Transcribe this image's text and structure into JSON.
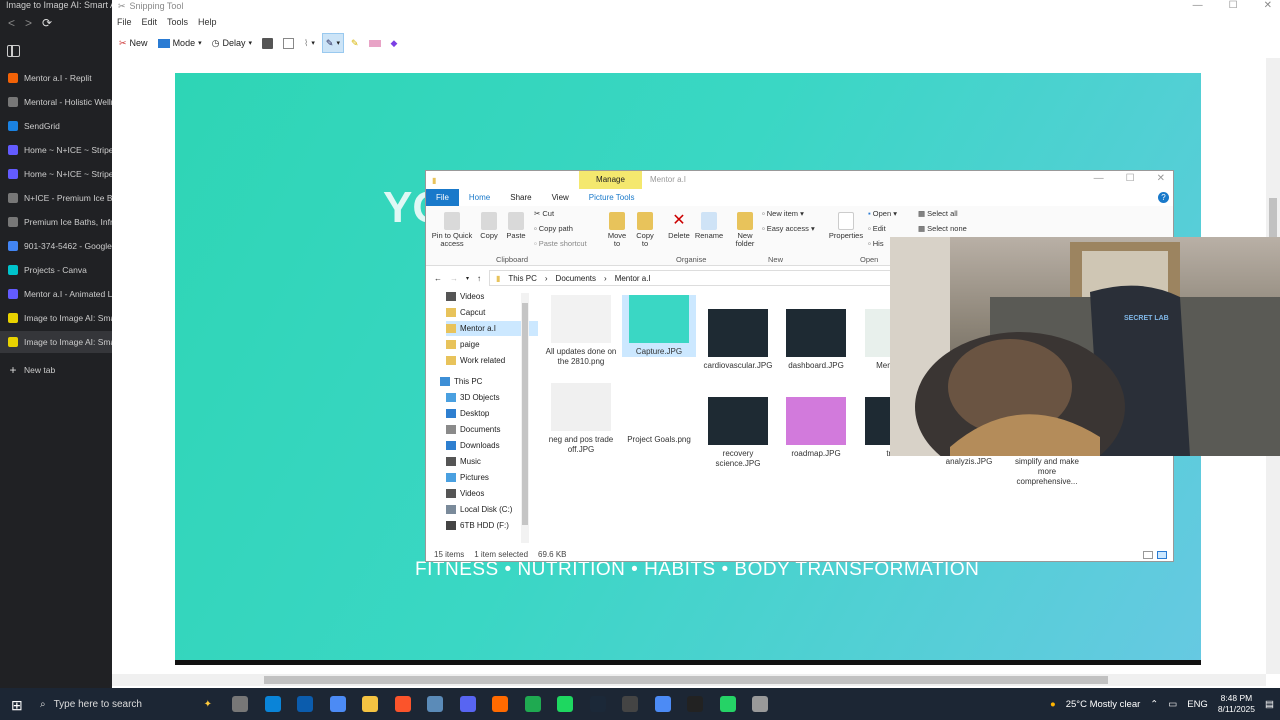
{
  "browser": {
    "title": "Image to Image AI: Smart AI I",
    "tabs": [
      {
        "label": "Mentor a.I - Replit",
        "icon": "replit-icon",
        "color": "#f26207"
      },
      {
        "label": "Mentoral - Holistic Welln",
        "icon": "globe-icon",
        "color": "#777777"
      },
      {
        "label": "SendGrid",
        "icon": "sendgrid-icon",
        "color": "#1a82e2"
      },
      {
        "label": "Home ~ N+ICE ~ Stripe",
        "icon": "stripe-icon",
        "color": "#635bff"
      },
      {
        "label": "Home ~ N+ICE ~ Stripe",
        "icon": "stripe-icon",
        "color": "#635bff"
      },
      {
        "label": "N+ICE - Premium Ice Bat",
        "icon": "globe-icon",
        "color": "#777777"
      },
      {
        "label": "Premium Ice Baths, Infra",
        "icon": "globe-icon",
        "color": "#777777"
      },
      {
        "label": "901-374-5462 - Google A",
        "icon": "google-ads-icon",
        "color": "#4285f4"
      },
      {
        "label": "Projects - Canva",
        "icon": "canva-icon",
        "color": "#00c4cc"
      },
      {
        "label": "Mentor a.I - Animated Lo",
        "icon": "stripe-icon",
        "color": "#635bff"
      },
      {
        "label": "Image to Image AI: Smar",
        "icon": "aitool-icon",
        "color": "#e8d200"
      },
      {
        "label": "Image to Image AI: Smar",
        "icon": "aitool-icon",
        "color": "#e8d200"
      }
    ],
    "new_tab": "New tab"
  },
  "snip": {
    "title": "Snipping Tool",
    "menu": [
      "File",
      "Edit",
      "Tools",
      "Help"
    ],
    "toolbar": {
      "new": "New",
      "mode": "Mode",
      "delay": "Delay"
    },
    "hero_partial": "YO",
    "hero_subtitle": "FITNESS • NUTRITION • HABITS • BODY TRANSFORMATION"
  },
  "explorer": {
    "manage": "Manage",
    "title": "Mentor a.I",
    "ribbon_tabs": [
      "File",
      "Home",
      "Share",
      "View",
      "Picture Tools"
    ],
    "clipboard": {
      "pin": "Pin to Quick access",
      "copy": "Copy",
      "paste": "Paste",
      "cut": "Cut",
      "copy_path": "Copy path",
      "paste_shortcut": "Paste shortcut",
      "label": "Clipboard"
    },
    "organize": {
      "move": "Move to",
      "copy": "Copy to",
      "delete": "Delete",
      "rename": "Rename",
      "label": "Organise"
    },
    "new": {
      "folder": "New folder",
      "item": "New item",
      "easy": "Easy access",
      "label": "New"
    },
    "open": {
      "properties": "Properties",
      "open": "Open",
      "edit": "Edit",
      "history": "His",
      "label": "Open"
    },
    "select": {
      "all": "Select all",
      "none": "Select none"
    },
    "path": [
      "This PC",
      "Documents",
      "Mentor a.I"
    ],
    "nav": [
      {
        "label": "Videos",
        "color": "#555"
      },
      {
        "label": "Capcut",
        "color": "#e8c35b"
      },
      {
        "label": "Mentor a.I",
        "color": "#e8c35b"
      },
      {
        "label": "paige",
        "color": "#e8c35b"
      },
      {
        "label": "Work related",
        "color": "#e8c35b"
      },
      {
        "label": "This PC",
        "color": "#3d8fd6"
      },
      {
        "label": "3D Objects",
        "color": "#4aa0e0"
      },
      {
        "label": "Desktop",
        "color": "#2e7fd0"
      },
      {
        "label": "Documents",
        "color": "#8a8a8a"
      },
      {
        "label": "Downloads",
        "color": "#2e7fd0"
      },
      {
        "label": "Music",
        "color": "#555"
      },
      {
        "label": "Pictures",
        "color": "#4aa0e0"
      },
      {
        "label": "Videos",
        "color": "#555"
      },
      {
        "label": "Local Disk (C:)",
        "color": "#7a8a9a"
      },
      {
        "label": "6TB HDD (F:)",
        "color": "#444"
      }
    ],
    "files": [
      {
        "name": "All updates done on the 2810.png",
        "thumb": "#f2f2f2"
      },
      {
        "name": "Capture.JPG",
        "thumb": "#3ad7c4"
      },
      {
        "name": "cardiovascular.JPG",
        "thumb": "#1e2a33"
      },
      {
        "name": "dashboard.JPG",
        "thumb": "#1e2a33"
      },
      {
        "name": "Ment 1024",
        "thumb": "#e8f0ec"
      },
      {
        "name": "neg and pos trade off.JPG",
        "thumb": "#f0f0f0"
      },
      {
        "name": "Project Goals.png",
        "thumb": "#ffffff"
      },
      {
        "name": "recovery science.JPG",
        "thumb": "#1e2a33"
      },
      {
        "name": "roadmap.JPG",
        "thumb": "#d27adc"
      },
      {
        "name": "track",
        "thumb": "#1e2a33"
      },
      {
        "name": "analyzis.JPG",
        "thumb": ""
      },
      {
        "name": "simplify and make more comprehensive...",
        "thumb": ""
      }
    ],
    "status": {
      "count": "15 items",
      "selected": "1 item selected",
      "size": "69.6 KB"
    }
  },
  "webcam": {
    "chair_brand": "SECRET LAB"
  },
  "taskbar": {
    "search_placeholder": "Type here to search",
    "weather": "25°C  Mostly clear",
    "lang": "ENG",
    "time": "8:48 PM",
    "date": "8/11/2025"
  }
}
